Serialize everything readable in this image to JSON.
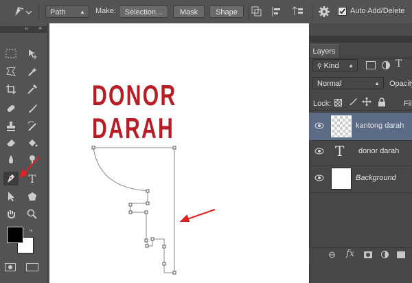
{
  "options_bar": {
    "tool_mode": "Path",
    "make_label": "Make:",
    "selection_button": "Selection...",
    "mask_button": "Mask",
    "shape_button": "Shape",
    "auto_add_delete_label": "Auto Add/Delete",
    "auto_add_delete_checked": true
  },
  "canvas": {
    "text_line1": "DONOR",
    "text_line2": "DARAH",
    "text_color": "#b81c24"
  },
  "layers_panel": {
    "tab_label": "Layers",
    "kind_filter": "Kind",
    "blend_mode": "Normal",
    "opacity_label": "Opacity",
    "lock_label": "Lock:",
    "fill_label": "Fill",
    "layers": [
      {
        "name": "kantong darah",
        "type": "pixel",
        "selected": true
      },
      {
        "name": "donor darah",
        "type": "text",
        "selected": false
      },
      {
        "name": "Background",
        "type": "background",
        "selected": false
      }
    ]
  },
  "colors": {
    "ui_bg": "#535353",
    "selected_layer": "#5b6b86",
    "annotation_arrow": "#e02020",
    "foreground": "#000000",
    "background": "#ffffff"
  }
}
